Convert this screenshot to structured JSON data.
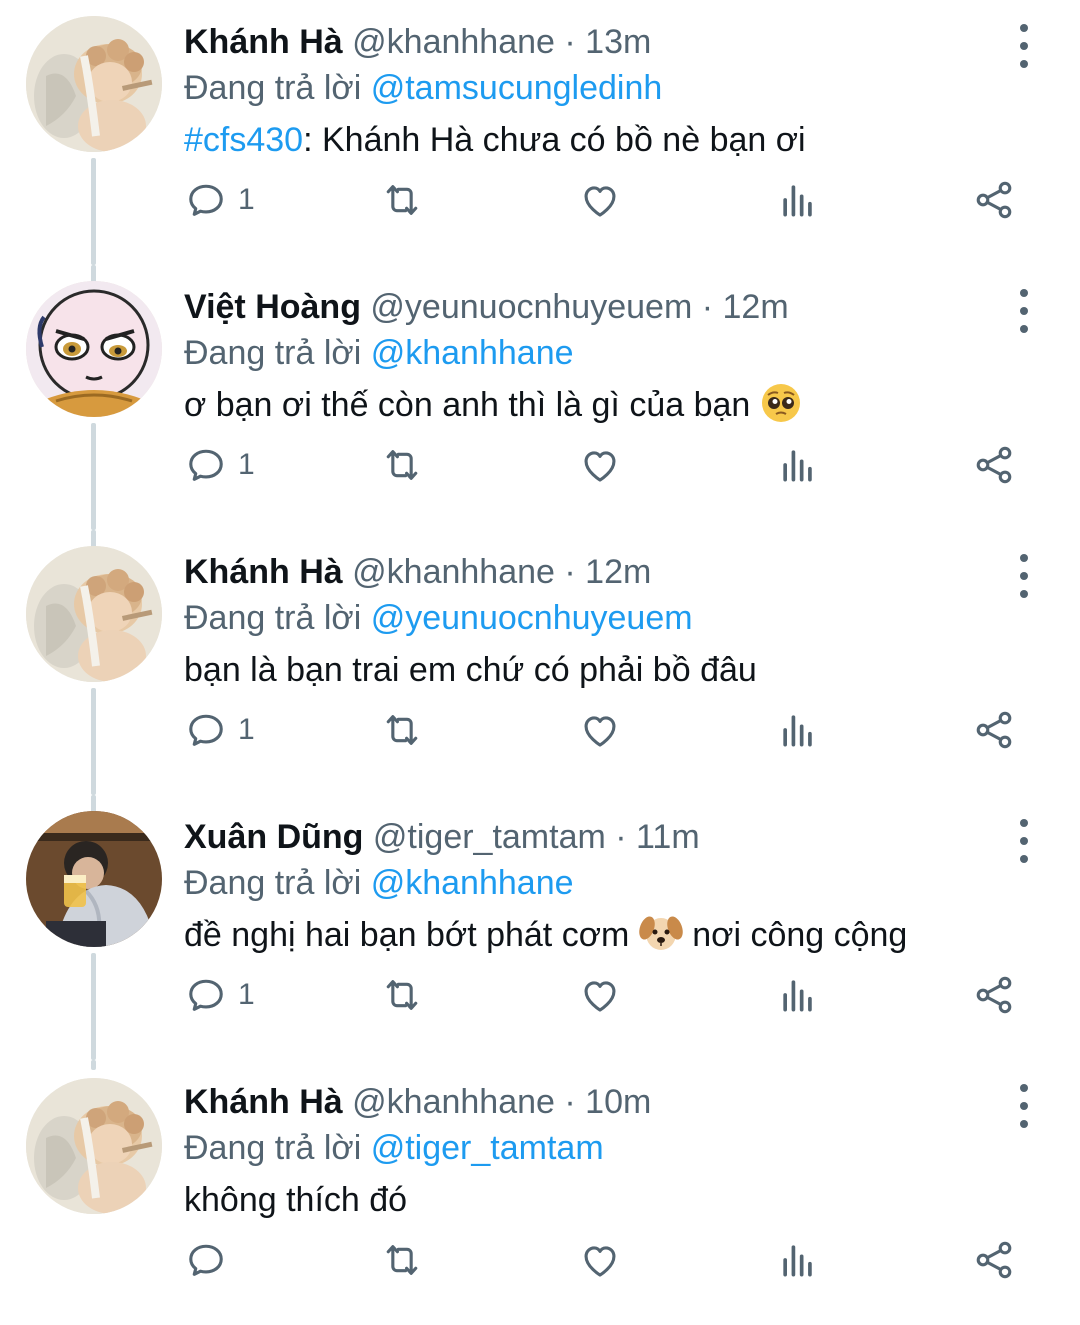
{
  "tweets": [
    {
      "name": "Khánh Hà",
      "handle": "@khanhhane",
      "time": "13m",
      "reply_prefix": "Đang trả lời",
      "reply_to": "@tamsucungledinh",
      "hashtag": "#cfs430",
      "text": ": Khánh Hà chưa có bồ nè bạn ơi",
      "replies": "1",
      "avatar": "cherub-avatar"
    },
    {
      "name": "Việt Hoàng",
      "handle": "@yeunuocnhuyeuem",
      "time": "12m",
      "reply_prefix": "Đang trả lời",
      "reply_to": "@khanhhane",
      "text": "ơ bạn ơi thế còn anh thì là gì của bạn",
      "emoji": "pleading-face-emoji",
      "replies": "1",
      "avatar": "cartoon-face-avatar"
    },
    {
      "name": "Khánh Hà",
      "handle": "@khanhhane",
      "time": "12m",
      "reply_prefix": "Đang trả lời",
      "reply_to": "@yeunuocnhuyeuem",
      "text": "bạn là bạn trai em chứ có phải bồ đâu",
      "replies": "1",
      "avatar": "cherub-avatar"
    },
    {
      "name": "Xuân Dũng",
      "handle": "@tiger_tamtam",
      "time": "11m",
      "reply_prefix": "Đang trả lời",
      "reply_to": "@khanhhane",
      "text_before": "đề nghị hai bạn bớt phát cơm",
      "emoji": "dog-face-emoji",
      "text_after": "nơi công cộng",
      "replies": "1",
      "avatar": "photo-avatar"
    },
    {
      "name": "Khánh Hà",
      "handle": "@khanhhane",
      "time": "10m",
      "reply_prefix": "Đang trả lời",
      "reply_to": "@tiger_tamtam",
      "text": "không thích đó",
      "replies": "",
      "avatar": "cherub-avatar"
    }
  ],
  "icons": {
    "reply": "reply-icon",
    "retweet": "retweet-icon",
    "like": "like-icon",
    "stats": "stats-icon",
    "share": "share-icon",
    "more": "more-options-icon"
  },
  "colors": {
    "link": "#1d9bf0",
    "secondary": "#536471",
    "text": "#0f1419",
    "thread_line": "#cfd9de"
  }
}
